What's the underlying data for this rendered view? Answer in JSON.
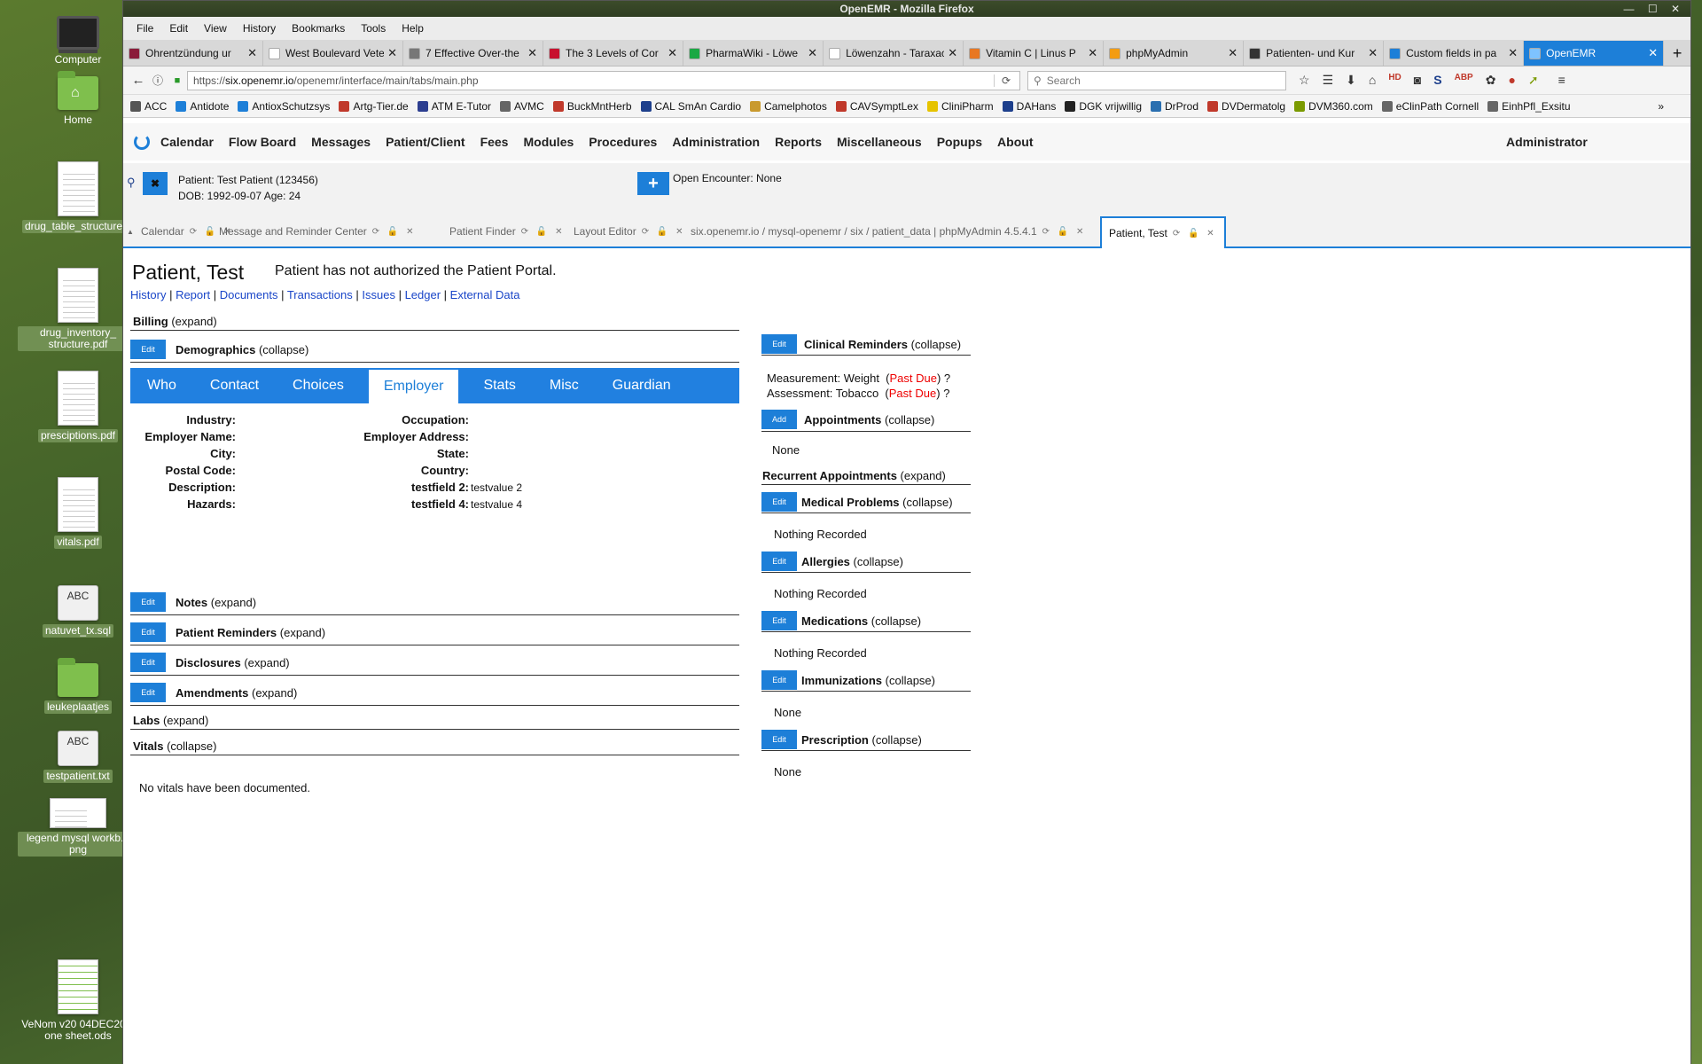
{
  "desktop": [
    {
      "label": "Computer",
      "kind": "monitor"
    },
    {
      "label": "Home",
      "kind": "home"
    },
    {
      "label": "drug_table_structure...",
      "kind": "doc",
      "selected": true
    },
    {
      "label": "drug_inventory_ structure.pdf",
      "kind": "doc",
      "selected": true
    },
    {
      "label": "presciptions.pdf",
      "kind": "doc",
      "selected": true
    },
    {
      "label": "vitals.pdf",
      "kind": "doc",
      "selected": true
    },
    {
      "label": "natuvet_tx.sql",
      "kind": "abc",
      "selected": true
    },
    {
      "label": "leukeplaatjes",
      "kind": "folder",
      "selected": true
    },
    {
      "label": "testpatient.txt",
      "kind": "abc",
      "selected": true
    },
    {
      "label": "legend mysql workb... png",
      "kind": "img",
      "selected": true
    },
    {
      "label": "VeNom v20 04DEC20... one sheet.ods",
      "kind": "sheet"
    }
  ],
  "window": {
    "title": "OpenEMR - Mozilla Firefox",
    "controls": "— ☐ ✕"
  },
  "menu": [
    "File",
    "Edit",
    "View",
    "History",
    "Bookmarks",
    "Tools",
    "Help"
  ],
  "browser_tabs": [
    {
      "title": "Ohrentzündung ur",
      "color": "#8a1c3a"
    },
    {
      "title": "West Boulevard Veterir",
      "color": "#ffffff"
    },
    {
      "title": "7 Effective Over-the",
      "color": "#777777"
    },
    {
      "title": "The 3 Levels of Cor",
      "color": "#c8102e"
    },
    {
      "title": "PharmaWiki - Löwe",
      "color": "#1aa844"
    },
    {
      "title": "Löwenzahn - Taraxacur",
      "color": "#ffffff"
    },
    {
      "title": "Vitamin C | Linus P",
      "color": "#e87722"
    },
    {
      "title": "phpMyAdmin",
      "color": "#f39c12"
    },
    {
      "title": "Patienten- und Kur",
      "color": "#333333"
    },
    {
      "title": "Custom fields in pa",
      "color": "#1d7fd8"
    },
    {
      "title": "OpenEMR",
      "color": "#7ec3ff",
      "active": true
    }
  ],
  "nav": {
    "url_prefix": "https://",
    "url_host": "six.openemr.io",
    "url_path": "/openemr/interface/main/tabs/main.php",
    "search_placeholder": "Search"
  },
  "bookmarks": [
    {
      "t": "ACC",
      "c": "#555"
    },
    {
      "t": "Antidote",
      "c": "#1d7fd8"
    },
    {
      "t": "AntioxSchutzsys",
      "c": "#1d7fd8"
    },
    {
      "t": "Artg-Tier.de",
      "c": "#c0392b"
    },
    {
      "t": "ATM E-Tutor",
      "c": "#2c3e90"
    },
    {
      "t": "AVMC",
      "c": "#666"
    },
    {
      "t": "BuckMntHerb",
      "c": "#c0392b"
    },
    {
      "t": "CAL SmAn Cardio",
      "c": "#1d3f8c"
    },
    {
      "t": "Camelphotos",
      "c": "#c99a2e"
    },
    {
      "t": "CAVSymptLex",
      "c": "#c0392b"
    },
    {
      "t": "CliniPharm",
      "c": "#e6c300"
    },
    {
      "t": "DAHans",
      "c": "#1d3f8c"
    },
    {
      "t": "DGK vrijwillig",
      "c": "#222"
    },
    {
      "t": "DrProd",
      "c": "#2a6fb0"
    },
    {
      "t": "DVDermatolg",
      "c": "#c0392b"
    },
    {
      "t": "DVM360.com",
      "c": "#7a9a00"
    },
    {
      "t": "eClinPath Cornell",
      "c": "#666"
    },
    {
      "t": "EinhPfl_Exsitu",
      "c": "#666"
    }
  ],
  "emr_menu": [
    "Calendar",
    "Flow Board",
    "Messages",
    "Patient/Client",
    "Fees",
    "Modules",
    "Procedures",
    "Administration",
    "Reports",
    "Miscellaneous",
    "Popups",
    "About"
  ],
  "user": "Administrator",
  "patient": {
    "label": "Patient:",
    "name": "Test Patient (123456)",
    "dob": "DOB: 1992-09-07 Age: 24",
    "encounter": "Open Encounter: None"
  },
  "app_tabs": [
    {
      "title": "Calendar"
    },
    {
      "title": "Message and Reminder Center"
    },
    {
      "title": "Patient Finder"
    },
    {
      "title": "Layout Editor"
    },
    {
      "title": "six.openemr.io / mysql-openemr / six / patient_data | phpMyAdmin 4.5.4.1"
    },
    {
      "title": "Patient, Test",
      "active": true
    }
  ],
  "page": {
    "title": "Patient, Test",
    "portal": "Patient has not authorized the Patient Portal.",
    "links": [
      "History",
      "Report",
      "Documents",
      "Transactions",
      "Issues",
      "Ledger",
      "External Data"
    ],
    "edit": "Edit",
    "add": "Add",
    "billing": {
      "name": "Billing",
      "state": "(expand)"
    },
    "demographics": {
      "name": "Demographics",
      "state": "(collapse)"
    },
    "demo_tabs": [
      "Who",
      "Contact",
      "Choices",
      "Employer",
      "Stats",
      "Misc",
      "Guardian"
    ],
    "fields_left": [
      "Industry:",
      "Employer Name:",
      "City:",
      "Postal Code:",
      "Description:",
      "Hazards:"
    ],
    "fields_right": [
      {
        "l": "Occupation:",
        "v": ""
      },
      {
        "l": "Employer Address:",
        "v": ""
      },
      {
        "l": "State:",
        "v": ""
      },
      {
        "l": "Country:",
        "v": ""
      },
      {
        "l": "testfield 2:",
        "v": "testvalue 2"
      },
      {
        "l": "testfield 4:",
        "v": "testvalue 4"
      }
    ],
    "notes": {
      "name": "Notes",
      "state": "(expand)"
    },
    "reminders": {
      "name": "Patient Reminders",
      "state": "(expand)"
    },
    "disclosures": {
      "name": "Disclosures",
      "state": "(expand)"
    },
    "amendments": {
      "name": "Amendments",
      "state": "(expand)"
    },
    "labs": {
      "name": "Labs",
      "state": "(expand)"
    },
    "vitals": {
      "name": "Vitals",
      "state": "(collapse)",
      "empty": "No vitals have been documented."
    },
    "clinical": {
      "name": "Clinical Reminders",
      "state": "(collapse)",
      "items": [
        {
          "a": "Measurement: Weight  (",
          "b": "Past Due",
          ") ?": ") ?"
        },
        {
          "a": "Assessment: Tobacco  (",
          "b": "Past Due"
        }
      ],
      "close": ") ?"
    },
    "appointments": {
      "name": "Appointments",
      "state": "(collapse)",
      "value": "None"
    },
    "recurrent": {
      "name": "Recurrent Appointments",
      "state": "(expand)"
    },
    "medical": {
      "name": "Medical Problems",
      "state": "(collapse)",
      "value": "Nothing Recorded"
    },
    "allergies": {
      "name": "Allergies",
      "state": "(collapse)",
      "value": "Nothing Recorded"
    },
    "medications": {
      "name": "Medications",
      "state": "(collapse)",
      "value": "Nothing Recorded"
    },
    "immunizations": {
      "name": "Immunizations",
      "state": "(collapse)",
      "value": "None"
    },
    "prescription": {
      "name": "Prescription",
      "state": "(collapse)",
      "value": "None"
    }
  }
}
